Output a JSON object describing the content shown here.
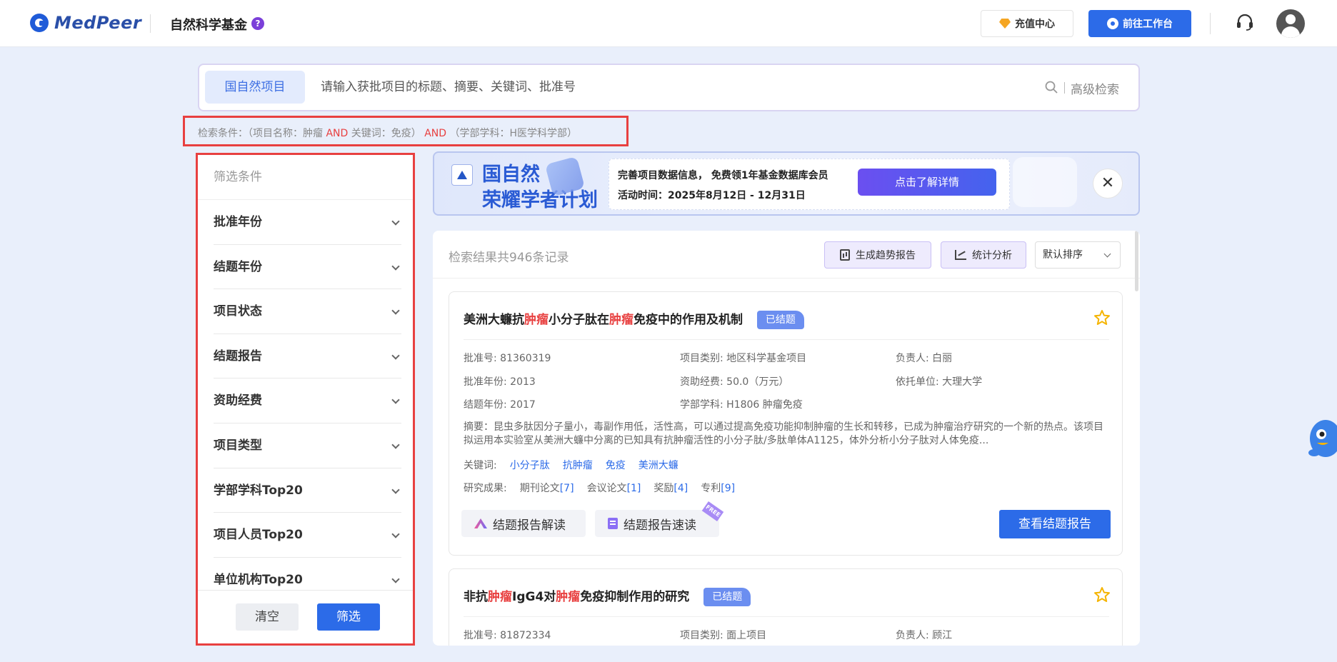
{
  "header": {
    "logo_text": "MedPeer",
    "site_title": "自然科学基金",
    "help_label": "?",
    "recharge_label": "充值中心",
    "workbench_label": "前往工作台"
  },
  "search": {
    "tab_label": "国自然项目",
    "placeholder": "请输入获批项目的标题、摘要、关键词、批准号",
    "advanced_label": "高级检索"
  },
  "conditions": {
    "prefix": "检索条件：（项目名称：肿瘤",
    "op1": "AND",
    "mid": "关键词：免疫）",
    "op2": "AND",
    "suffix": "（学部学科：H医学科学部）"
  },
  "sidebar": {
    "title": "筛选条件",
    "items": [
      {
        "label": "批准年份"
      },
      {
        "label": "结题年份"
      },
      {
        "label": "项目状态"
      },
      {
        "label": "结题报告"
      },
      {
        "label": "资助经费"
      },
      {
        "label": "项目类型"
      },
      {
        "label": "学部学科Top20"
      },
      {
        "label": "项目人员Top20"
      },
      {
        "label": "单位机构Top20"
      }
    ],
    "clear_label": "清空",
    "filter_label": "筛选"
  },
  "banner": {
    "title_line1": "国自然",
    "title_line2": "荣耀学者计划",
    "line1": "完善项目数据信息， 免费领1年基金数据库会员",
    "line2": "活动时间：2025年8月12日 - 12月31日",
    "button_label": "点击了解详情",
    "close_label": "✕"
  },
  "results": {
    "count_text": "检索结果共946条记录",
    "trend_label": "生成趋势报告",
    "stat_label": "统计分析",
    "sort_label": "默认排序",
    "cards": [
      {
        "title_parts": [
          "美洲大蠊抗",
          "肿瘤",
          "小分子肽在",
          "肿瘤",
          "免疫中的作用及机制"
        ],
        "status": "已结题",
        "approval_no": "批准号: 81360319",
        "category": "项目类别: 地区科学基金项目",
        "leader": "负责人: 白丽",
        "approval_year": "批准年份: 2013",
        "funding": "资助经费: 50.0（万元）",
        "institution": "依托单位: 大理大学",
        "end_year": "结题年份: 2017",
        "discipline": "学部学科: H1806 肿瘤免疫",
        "abstract": "摘要：昆虫多肽因分子量小，毒副作用低，活性高，可以通过提高免疫功能抑制肿瘤的生长和转移，已成为肿瘤治疗研究的一个新的热点。该项目拟运用本实验室从美洲大蠊中分离的已知具有抗肿瘤活性的小分子肽/多肽单体A1125，体外分析小分子肽对人体免疫...",
        "keywords_label": "关键词:",
        "keywords": [
          "小分子肽",
          "抗肿瘤",
          "免疫",
          "美洲大蠊"
        ],
        "achievements_label": "研究成果:",
        "achievements": [
          {
            "name": "期刊论文",
            "count": "[7]"
          },
          {
            "name": "会议论文",
            "count": "[1]"
          },
          {
            "name": "奖励",
            "count": "[4]"
          },
          {
            "name": "专利",
            "count": "[9]"
          }
        ],
        "tool1": "结题报告解读",
        "tool2": "结题报告速读",
        "free_badge": "FREE",
        "view_report": "查看结题报告"
      },
      {
        "title_parts": [
          "非抗",
          "肿瘤",
          "IgG4对",
          "肿瘤",
          "免疫抑制作用的研究"
        ],
        "status": "已结题",
        "approval_no": "批准号: 81872334",
        "category": "项目类别: 面上项目",
        "leader": "负责人: 顾江"
      }
    ]
  },
  "colors": {
    "accent": "#2c6be8",
    "highlight": "#e84040",
    "tag": "#6b8ef0"
  }
}
